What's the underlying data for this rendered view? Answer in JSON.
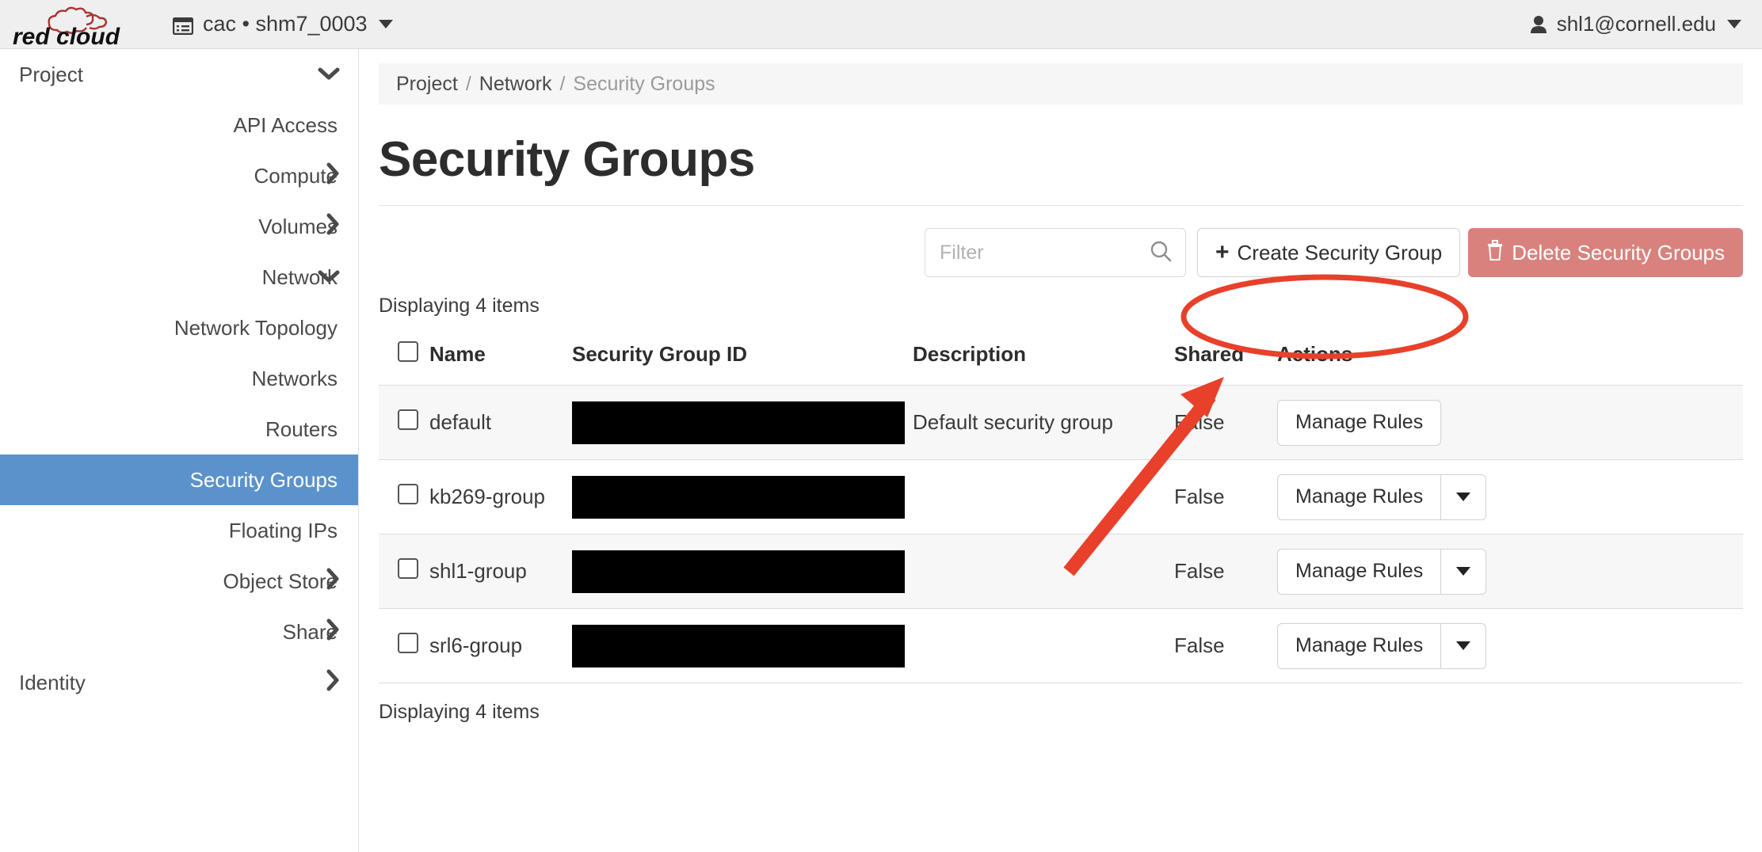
{
  "header": {
    "logo_text": "red cloud",
    "logo_icon": "cloud-icon",
    "project_icon": "project-list-icon",
    "project_label": "cac • shm7_0003",
    "project_caret": "chevron-down-icon",
    "user_icon": "user-icon",
    "user_label": "shl1@cornell.edu",
    "user_caret": "chevron-down-icon"
  },
  "sidebar": {
    "items": [
      {
        "label": "Project",
        "level": 0,
        "chevron": "chevron-down-icon",
        "active": false
      },
      {
        "label": "API Access",
        "level": 1,
        "chevron": "",
        "active": false
      },
      {
        "label": "Compute",
        "level": 1,
        "chevron": "chevron-right-icon",
        "active": false
      },
      {
        "label": "Volumes",
        "level": 1,
        "chevron": "chevron-right-icon",
        "active": false
      },
      {
        "label": "Network",
        "level": 1,
        "chevron": "chevron-down-icon",
        "active": false
      },
      {
        "label": "Network Topology",
        "level": 2,
        "chevron": "",
        "active": false
      },
      {
        "label": "Networks",
        "level": 2,
        "chevron": "",
        "active": false
      },
      {
        "label": "Routers",
        "level": 2,
        "chevron": "",
        "active": false
      },
      {
        "label": "Security Groups",
        "level": 2,
        "chevron": "",
        "active": true
      },
      {
        "label": "Floating IPs",
        "level": 2,
        "chevron": "",
        "active": false
      },
      {
        "label": "Object Store",
        "level": 1,
        "chevron": "chevron-right-icon",
        "active": false
      },
      {
        "label": "Share",
        "level": 1,
        "chevron": "chevron-right-icon",
        "active": false
      },
      {
        "label": "Identity",
        "level": 0,
        "chevron": "chevron-right-icon",
        "active": false
      }
    ]
  },
  "breadcrumb": {
    "project": "Project",
    "sep1": "/",
    "network": "Network",
    "sep2": "/",
    "current": "Security Groups"
  },
  "page": {
    "title": "Security Groups",
    "count_top": "Displaying 4 items",
    "count_bottom": "Displaying 4 items"
  },
  "toolbar": {
    "filter_placeholder": "Filter",
    "filter_value": "",
    "search_icon": "search-icon",
    "create_label": "Create Security Group",
    "create_icon": "plus-icon",
    "delete_label": "Delete Security Groups",
    "delete_icon": "trash-icon",
    "delete_color": "#d9827d"
  },
  "table": {
    "headers": {
      "select_all": "select-all-checkbox",
      "name": "Name",
      "id": "Security Group ID",
      "description": "Description",
      "shared": "Shared",
      "actions": "Actions"
    },
    "rows": [
      {
        "name": "default",
        "id_redacted": true,
        "description": "Default security group",
        "shared": "False",
        "action_label": "Manage Rules",
        "has_caret": false
      },
      {
        "name": "kb269-group",
        "id_redacted": true,
        "description": "",
        "shared": "False",
        "action_label": "Manage Rules",
        "has_caret": true
      },
      {
        "name": "shl1-group",
        "id_redacted": true,
        "description": "",
        "shared": "False",
        "action_label": "Manage Rules",
        "has_caret": true
      },
      {
        "name": "srl6-group",
        "id_redacted": true,
        "description": "",
        "shared": "False",
        "action_label": "Manage Rules",
        "has_caret": true
      }
    ]
  },
  "annotations": {
    "highlight_color": "#e8402a",
    "ellipse_target": "create-security-group-button",
    "arrow_target": "create-security-group-button"
  },
  "colors": {
    "active_nav": "#5b92cb",
    "topbar_bg": "#efeff0",
    "row_stripe": "#f7f7f7"
  }
}
